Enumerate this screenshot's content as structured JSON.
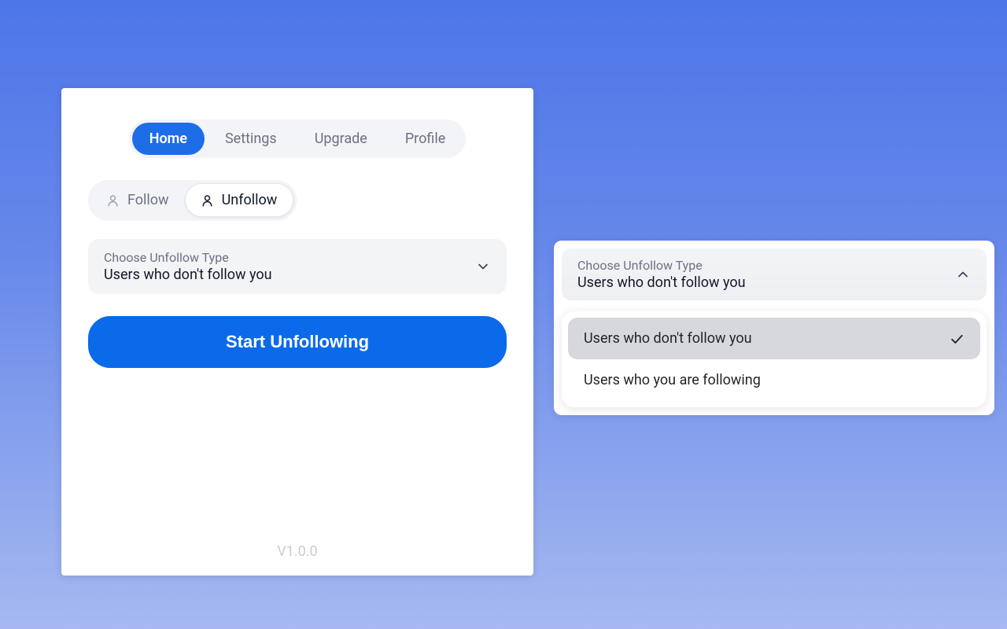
{
  "nav": {
    "tabs": [
      {
        "label": "Home",
        "active": true
      },
      {
        "label": "Settings",
        "active": false
      },
      {
        "label": "Upgrade",
        "active": false
      },
      {
        "label": "Profile",
        "active": false
      }
    ]
  },
  "mode": {
    "follow_label": "Follow",
    "unfollow_label": "Unfollow"
  },
  "dropdown": {
    "label": "Choose Unfollow Type",
    "value": "Users who don't follow you"
  },
  "primary_action": {
    "label": "Start Unfollowing"
  },
  "version": "V1.0.0",
  "expanded": {
    "label": "Choose Unfollow Type",
    "value": "Users who don't follow you",
    "options": [
      {
        "label": "Users who don't follow you",
        "selected": true
      },
      {
        "label": "Users who you are following",
        "selected": false
      }
    ]
  }
}
